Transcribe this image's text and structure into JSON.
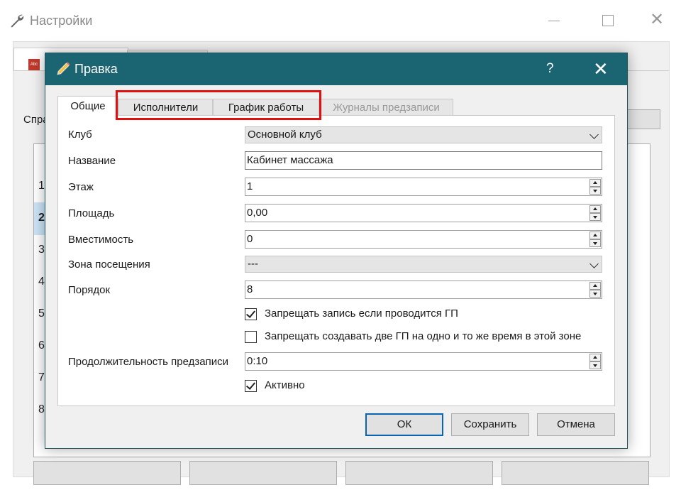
{
  "background_window": {
    "title": "Настройки",
    "label_prefix": "Спра",
    "row_numbers": [
      "1",
      "2",
      "3",
      "4",
      "5",
      "6",
      "7",
      "8"
    ]
  },
  "dialog": {
    "title": "Правка",
    "help_glyph": "?",
    "close_glyph": "✕",
    "tabs": [
      {
        "label": "Общие",
        "state": "active"
      },
      {
        "label": "Исполнители",
        "state": "normal"
      },
      {
        "label": "График работы",
        "state": "normal"
      },
      {
        "label": "Журналы предзаписи",
        "state": "disabled"
      }
    ],
    "fields": {
      "club": {
        "label": "Клуб",
        "value": "Основной клуб"
      },
      "name": {
        "label": "Название",
        "value": "Кабинет массажа"
      },
      "floor": {
        "label": "Этаж",
        "value": "1"
      },
      "area": {
        "label": "Площадь",
        "value": "0,00"
      },
      "capacity": {
        "label": "Вместимость",
        "value": "0"
      },
      "zone": {
        "label": "Зона посещения",
        "value": "---"
      },
      "order": {
        "label": "Порядок",
        "value": "8"
      },
      "forbid_if_gp": {
        "label": "Запрещать запись если проводится ГП",
        "checked": true
      },
      "forbid_two_gp": {
        "label": "Запрещать создавать две ГП на одно и то же время в этой зоне",
        "checked": false
      },
      "prebook_duration": {
        "label": "Продолжительность предзаписи",
        "value": "0:10"
      },
      "active": {
        "label": "Активно",
        "checked": true
      }
    },
    "buttons": {
      "ok": "ОК",
      "save": "Сохранить",
      "cancel": "Отмена"
    }
  },
  "colors": {
    "titlebar": "#1b6472",
    "highlight": "#e01010",
    "default_button_border": "#0a64b4"
  }
}
